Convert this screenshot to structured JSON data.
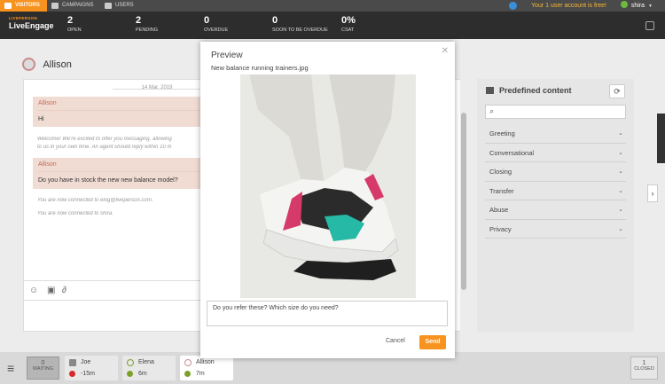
{
  "topnav": {
    "tabs": [
      {
        "label": "Visitors",
        "icon": "visitors-icon"
      },
      {
        "label": "Campaigns",
        "icon": "tag-icon"
      },
      {
        "label": "Users",
        "icon": "user-icon"
      }
    ],
    "free_notice": "Your 1 user account is free!",
    "user_name": "shira"
  },
  "header": {
    "brand_small": "LIVEPERSON",
    "brand": "LiveEngage",
    "stats": [
      {
        "value": "2",
        "label": "Open"
      },
      {
        "value": "2",
        "label": "Pending"
      },
      {
        "value": "0",
        "label": "Overdue"
      },
      {
        "value": "0",
        "label": "Soon to be overdue"
      },
      {
        "value": "0%",
        "label": "CSAT"
      }
    ]
  },
  "conversation": {
    "name": "Allison",
    "date": "14 Mar. 2019",
    "messages": [
      {
        "author": "Allison",
        "text": "Hi"
      },
      {
        "author": "Allison",
        "text": "Do you have in stock the new new balance model?"
      }
    ],
    "system_messages": [
      "Welcome! We're excited to offer you messaging, allowing",
      "to us in your own time. An agent should reply within 10 m",
      "You are now connected to elog@liveperson.com.",
      "You are now connected to shira."
    ]
  },
  "predefined": {
    "title": "Predefined content",
    "categories": [
      "Greeting",
      "Conversational",
      "Closing",
      "Transfer",
      "Abuse",
      "Privacy"
    ]
  },
  "preview": {
    "title": "Preview",
    "file_name": "New balance running trainers.jpg",
    "message": "Do you refer these? Which size do you need?",
    "cancel_label": "Cancel",
    "send_label": "Send"
  },
  "bottom": {
    "waiting_count": "0",
    "waiting_label": "WAITING",
    "conversations": [
      {
        "name": "Joe",
        "time": "-15m"
      },
      {
        "name": "Elena",
        "time": "6m"
      },
      {
        "name": "Allison",
        "time": "7m"
      }
    ],
    "closed_count": "1",
    "closed_label": "CLOSED"
  },
  "colors": {
    "accent": "#f7931e",
    "dark_bar": "#2d2d2d",
    "bubble": "#f0dcd3"
  }
}
